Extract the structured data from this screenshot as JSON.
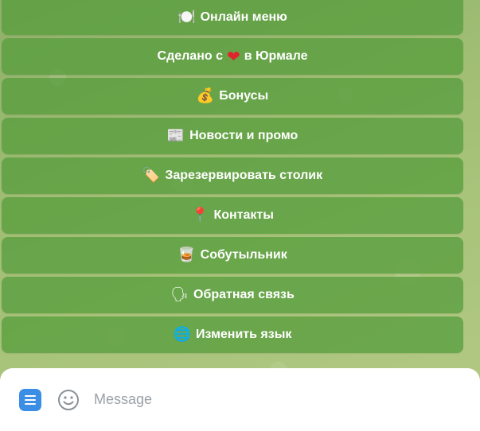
{
  "keyboard": {
    "buttons": [
      {
        "icon": "🍽️",
        "icon_name": "plate-icon",
        "label": "Онлайн меню"
      },
      {
        "label_before": "Сделано с",
        "icon": "❤",
        "icon_name": "heart-icon",
        "label_after": "в Юрмале"
      },
      {
        "icon": "💰",
        "icon_name": "money-bag-icon",
        "label": "Бонусы"
      },
      {
        "icon": "📰",
        "icon_name": "newspaper-icon",
        "label": "Новости и промо"
      },
      {
        "icon": "🏷️",
        "icon_name": "ticket-icon",
        "label": "Зарезервировать столик"
      },
      {
        "icon": "📍",
        "icon_name": "pin-icon",
        "label": "Контакты"
      },
      {
        "icon": "🥃",
        "icon_name": "whiskey-glass-icon",
        "label": "Собутыльник"
      },
      {
        "icon": "🗣",
        "icon_name": "speech-head-icon",
        "label": "Обратная связь"
      },
      {
        "icon": "🌐",
        "icon_name": "globe-icon",
        "label": "Изменить язык"
      }
    ]
  },
  "composer": {
    "placeholder": "Message",
    "value": ""
  },
  "colors": {
    "button_bg": "#589e3e",
    "menu_button": "#3a8ee6"
  }
}
